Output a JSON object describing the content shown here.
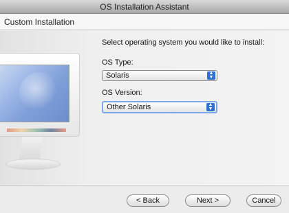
{
  "window": {
    "title": "OS Installation Assistant"
  },
  "header": {
    "title": "Custom Installation"
  },
  "form": {
    "prompt": "Select operating system you would like to install:",
    "os_type": {
      "label": "OS Type:",
      "value": "Solaris"
    },
    "os_version": {
      "label": "OS Version:",
      "value": "Other Solaris"
    }
  },
  "buttons": {
    "back": "< Back",
    "next": "Next >",
    "cancel": "Cancel"
  },
  "illustration": {
    "icon": "imac-icon"
  },
  "colors": {
    "accent": "#2f6fd1",
    "focus_ring": "#7aa8e8"
  }
}
